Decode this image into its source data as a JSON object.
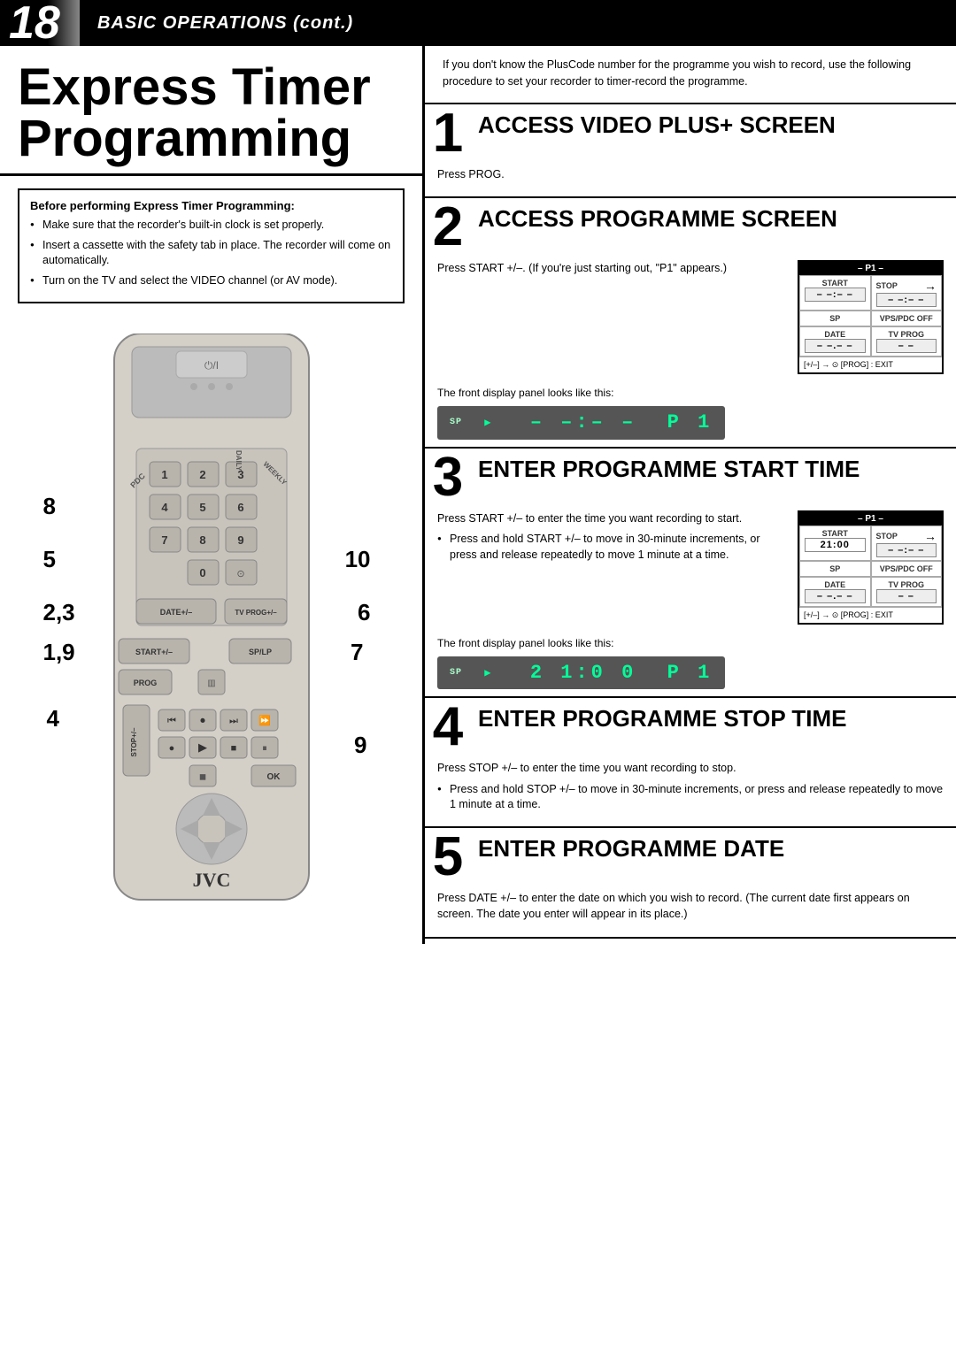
{
  "header": {
    "number": "18",
    "title": "BASIC OPERATIONS (cont.)"
  },
  "page_title": {
    "line1": "Express Timer",
    "line2": "Programming"
  },
  "before_note": {
    "title": "Before performing Express Timer Programming:",
    "items": [
      "Make sure that the recorder's built-in clock is set properly.",
      "Insert a cassette with the safety tab in place. The recorder will come on automatically.",
      "Turn on the TV and select the VIDEO channel (or AV mode)."
    ]
  },
  "intro_text": "If you don't know the PlusCode number for the programme you wish to record, use the following procedure to set your recorder to timer-record the programme.",
  "steps": [
    {
      "number": "1",
      "title": "ACCESS VIDEO PLUS+ SCREEN",
      "body_text": "Press PROG.",
      "has_lcd": false
    },
    {
      "number": "2",
      "title": "ACCESS PROGRAMME SCREEN",
      "body_text": "Press START +/–. (If you're just starting out, \"P1\" appears.)",
      "display_text": "SP ▶  – –:– –  P 1",
      "lcd_title": "– P1 –",
      "lcd_start_label": "START",
      "lcd_start_value": "– –:– –",
      "lcd_stop_label": "STOP",
      "lcd_stop_value": "– –:– –",
      "lcd_sp_label": "SP",
      "lcd_vps_label": "VPS/PDC OFF",
      "lcd_date_label": "DATE",
      "lcd_date_value": "– –.– –",
      "lcd_tvprog_label": "TV PROG",
      "lcd_tvprog_value": "– –",
      "lcd_bottom": "[+/–] → ⊙  [PROG] : EXIT",
      "display_label": "The front display panel looks like this:"
    },
    {
      "number": "3",
      "title": "ENTER PROGRAMME START TIME",
      "body_text": "Press START +/– to enter the time you want recording to start.",
      "bullet1": "Press and hold START +/– to move in 30-minute increments, or press and release repeatedly to move 1 minute at a time.",
      "display_text": "SP ▶  2 1:0 0  P 1",
      "lcd_title": "– P1 –",
      "lcd_start_label": "START",
      "lcd_start_value": "21:00",
      "lcd_stop_label": "STOP",
      "lcd_stop_value": "– –:– –",
      "lcd_sp_label": "SP",
      "lcd_vps_label": "VPS/PDC OFF",
      "lcd_date_label": "DATE",
      "lcd_date_value": "– –.– –",
      "lcd_tvprog_label": "TV PROG",
      "lcd_tvprog_value": "– –",
      "lcd_bottom": "[+/–] → ⊙  [PROG] : EXIT",
      "display_label": "The front display panel looks like this:"
    },
    {
      "number": "4",
      "title": "ENTER PROGRAMME STOP TIME",
      "body_text": "Press STOP +/– to enter the time you want recording to stop.",
      "bullet1": "Press and hold STOP +/– to move in 30-minute increments, or press and release repeatedly to move 1 minute at a time."
    },
    {
      "number": "5",
      "title": "ENTER PROGRAMME DATE",
      "body_text": "Press DATE +/– to enter the date on which you wish to record. (The current date first appears on screen. The date you enter will appear in its place.)"
    }
  ],
  "labels": {
    "pdc": "PDC",
    "daily": "DAILY",
    "weekly": "WEEKLY",
    "start_plus_minus": "START+/–",
    "prog": "PROG",
    "sp_lp": "SP/LP",
    "stop_plus_minus": "STOP+/–",
    "tv_prog_plus_minus": "TV PROG+/–",
    "ok": "OK",
    "jvc": "JVC",
    "num8": "8",
    "num5": "5",
    "num23": "2,3",
    "num19": "1,9",
    "num4": "4",
    "num10": "10",
    "num6": "6",
    "num7": "7",
    "num9": "9"
  }
}
